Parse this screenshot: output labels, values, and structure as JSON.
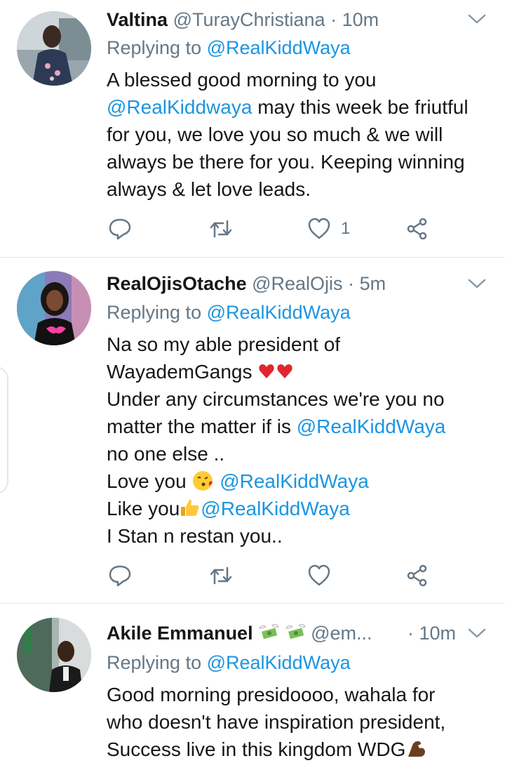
{
  "tweets": [
    {
      "name": "Valtina",
      "handle": "@TurayChristiana",
      "time": "10m",
      "replying_prefix": "Replying to",
      "replying_to": "@RealKiddWaya",
      "body": {
        "l1": "A blessed good morning to you",
        "l2_mention": "@RealKiddwaya",
        "l2_rest": " may this week be friutful",
        "l3": "for you, we love you so much & we will",
        "l4": "always be there for you. Keeping winning",
        "l5": "always & let love leads."
      },
      "like_count": "1"
    },
    {
      "name": "RealOjisOtache",
      "handle": "@RealOjis",
      "time": "5m",
      "replying_prefix": "Replying to",
      "replying_to": "@RealKiddWaya",
      "body": {
        "l1": "Na so my able president of",
        "l2": "WayademGangs ",
        "l3": "Under any circumstances we're you no",
        "l4_text": "matter the matter if is ",
        "l4_mention": "@RealKiddWaya",
        "l5": "no one else ..",
        "l6_text": "Love you ",
        "l6_mention": "@RealKiddWaya",
        "l7_text": "Like you",
        "l7_mention": "@RealKiddWaya",
        "l8": "I Stan n restan you.."
      }
    },
    {
      "name": "Akile Emmanuel",
      "handle": "@em...",
      "time": "10m",
      "replying_prefix": "Replying to",
      "replying_to": "@RealKiddWaya",
      "body": {
        "l1": "Good morning presidoooo, wahala for",
        "l2": "who doesn't have inspiration president,",
        "l3": "Success live in this kingdom WDG"
      }
    }
  ],
  "icons": [
    "reply-icon",
    "retweet-icon",
    "like-icon",
    "share-icon",
    "chevron-down-icon"
  ],
  "colors": {
    "mention": "#1b95e0",
    "secondary": "#657786",
    "divider": "#e1e8ed"
  }
}
